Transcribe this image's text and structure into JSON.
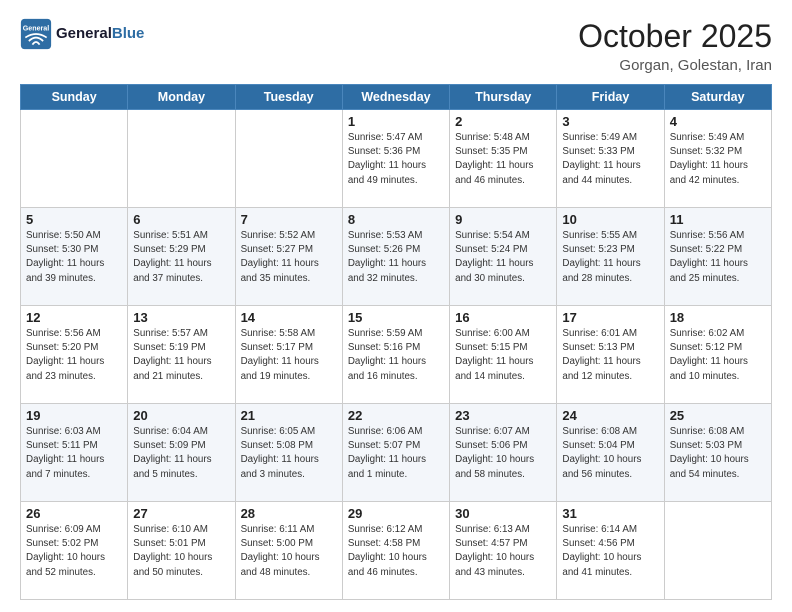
{
  "header": {
    "logo_line1": "General",
    "logo_line2": "Blue",
    "month": "October 2025",
    "location": "Gorgan, Golestan, Iran"
  },
  "weekdays": [
    "Sunday",
    "Monday",
    "Tuesday",
    "Wednesday",
    "Thursday",
    "Friday",
    "Saturday"
  ],
  "weeks": [
    [
      {
        "day": "",
        "info": ""
      },
      {
        "day": "",
        "info": ""
      },
      {
        "day": "",
        "info": ""
      },
      {
        "day": "1",
        "info": "Sunrise: 5:47 AM\nSunset: 5:36 PM\nDaylight: 11 hours\nand 49 minutes."
      },
      {
        "day": "2",
        "info": "Sunrise: 5:48 AM\nSunset: 5:35 PM\nDaylight: 11 hours\nand 46 minutes."
      },
      {
        "day": "3",
        "info": "Sunrise: 5:49 AM\nSunset: 5:33 PM\nDaylight: 11 hours\nand 44 minutes."
      },
      {
        "day": "4",
        "info": "Sunrise: 5:49 AM\nSunset: 5:32 PM\nDaylight: 11 hours\nand 42 minutes."
      }
    ],
    [
      {
        "day": "5",
        "info": "Sunrise: 5:50 AM\nSunset: 5:30 PM\nDaylight: 11 hours\nand 39 minutes."
      },
      {
        "day": "6",
        "info": "Sunrise: 5:51 AM\nSunset: 5:29 PM\nDaylight: 11 hours\nand 37 minutes."
      },
      {
        "day": "7",
        "info": "Sunrise: 5:52 AM\nSunset: 5:27 PM\nDaylight: 11 hours\nand 35 minutes."
      },
      {
        "day": "8",
        "info": "Sunrise: 5:53 AM\nSunset: 5:26 PM\nDaylight: 11 hours\nand 32 minutes."
      },
      {
        "day": "9",
        "info": "Sunrise: 5:54 AM\nSunset: 5:24 PM\nDaylight: 11 hours\nand 30 minutes."
      },
      {
        "day": "10",
        "info": "Sunrise: 5:55 AM\nSunset: 5:23 PM\nDaylight: 11 hours\nand 28 minutes."
      },
      {
        "day": "11",
        "info": "Sunrise: 5:56 AM\nSunset: 5:22 PM\nDaylight: 11 hours\nand 25 minutes."
      }
    ],
    [
      {
        "day": "12",
        "info": "Sunrise: 5:56 AM\nSunset: 5:20 PM\nDaylight: 11 hours\nand 23 minutes."
      },
      {
        "day": "13",
        "info": "Sunrise: 5:57 AM\nSunset: 5:19 PM\nDaylight: 11 hours\nand 21 minutes."
      },
      {
        "day": "14",
        "info": "Sunrise: 5:58 AM\nSunset: 5:17 PM\nDaylight: 11 hours\nand 19 minutes."
      },
      {
        "day": "15",
        "info": "Sunrise: 5:59 AM\nSunset: 5:16 PM\nDaylight: 11 hours\nand 16 minutes."
      },
      {
        "day": "16",
        "info": "Sunrise: 6:00 AM\nSunset: 5:15 PM\nDaylight: 11 hours\nand 14 minutes."
      },
      {
        "day": "17",
        "info": "Sunrise: 6:01 AM\nSunset: 5:13 PM\nDaylight: 11 hours\nand 12 minutes."
      },
      {
        "day": "18",
        "info": "Sunrise: 6:02 AM\nSunset: 5:12 PM\nDaylight: 11 hours\nand 10 minutes."
      }
    ],
    [
      {
        "day": "19",
        "info": "Sunrise: 6:03 AM\nSunset: 5:11 PM\nDaylight: 11 hours\nand 7 minutes."
      },
      {
        "day": "20",
        "info": "Sunrise: 6:04 AM\nSunset: 5:09 PM\nDaylight: 11 hours\nand 5 minutes."
      },
      {
        "day": "21",
        "info": "Sunrise: 6:05 AM\nSunset: 5:08 PM\nDaylight: 11 hours\nand 3 minutes."
      },
      {
        "day": "22",
        "info": "Sunrise: 6:06 AM\nSunset: 5:07 PM\nDaylight: 11 hours\nand 1 minute."
      },
      {
        "day": "23",
        "info": "Sunrise: 6:07 AM\nSunset: 5:06 PM\nDaylight: 10 hours\nand 58 minutes."
      },
      {
        "day": "24",
        "info": "Sunrise: 6:08 AM\nSunset: 5:04 PM\nDaylight: 10 hours\nand 56 minutes."
      },
      {
        "day": "25",
        "info": "Sunrise: 6:08 AM\nSunset: 5:03 PM\nDaylight: 10 hours\nand 54 minutes."
      }
    ],
    [
      {
        "day": "26",
        "info": "Sunrise: 6:09 AM\nSunset: 5:02 PM\nDaylight: 10 hours\nand 52 minutes."
      },
      {
        "day": "27",
        "info": "Sunrise: 6:10 AM\nSunset: 5:01 PM\nDaylight: 10 hours\nand 50 minutes."
      },
      {
        "day": "28",
        "info": "Sunrise: 6:11 AM\nSunset: 5:00 PM\nDaylight: 10 hours\nand 48 minutes."
      },
      {
        "day": "29",
        "info": "Sunrise: 6:12 AM\nSunset: 4:58 PM\nDaylight: 10 hours\nand 46 minutes."
      },
      {
        "day": "30",
        "info": "Sunrise: 6:13 AM\nSunset: 4:57 PM\nDaylight: 10 hours\nand 43 minutes."
      },
      {
        "day": "31",
        "info": "Sunrise: 6:14 AM\nSunset: 4:56 PM\nDaylight: 10 hours\nand 41 minutes."
      },
      {
        "day": "",
        "info": ""
      }
    ]
  ]
}
